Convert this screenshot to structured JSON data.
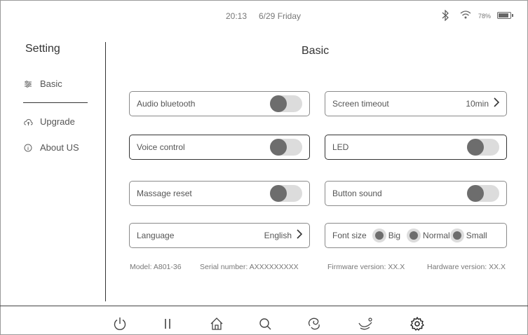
{
  "status": {
    "time": "20:13",
    "date": "6/29 Friday",
    "battery": "78%",
    "battery_level": 0.78,
    "icons": [
      "bluetooth-icon",
      "wifi-icon",
      "battery-icon"
    ]
  },
  "sidebar": {
    "title": "Setting",
    "items": [
      {
        "label": "Basic",
        "icon": "sliders-icon",
        "selected": true
      },
      {
        "label": "Upgrade",
        "icon": "cloud-upload-icon"
      },
      {
        "label": "About US",
        "icon": "info-icon"
      }
    ]
  },
  "main": {
    "title": "Basic",
    "left_cards": [
      {
        "label": "Audio bluetooth",
        "toggle": false
      },
      {
        "label": "Voice control",
        "toggle": false
      },
      {
        "label": "Massage reset",
        "toggle": false
      },
      {
        "label": "Language",
        "value": "English"
      }
    ],
    "right_cards": [
      {
        "label": "Screen timeout",
        "value": "10min"
      },
      {
        "label": "LED",
        "toggle": false
      },
      {
        "label": "Button sound",
        "toggle": false
      },
      {
        "label": "Font size",
        "options": [
          "Big",
          "Normal",
          "Small"
        ]
      }
    ],
    "info": {
      "model": "Model: A801-36",
      "serial": "Serial number: AXXXXXXXXX",
      "firmware": "Firmware version: XX.X",
      "hardware": "Hardware version: XX.X"
    }
  },
  "bottom_nav": [
    "power-icon",
    "pause-icon",
    "home-icon",
    "search-icon",
    "massage-hand-icon",
    "recline-icon",
    "gear-icon"
  ],
  "colors": {
    "toggle_track": "#dcdcdc",
    "toggle_knob": "#6d6d6d",
    "border": "#8a8a8a"
  }
}
